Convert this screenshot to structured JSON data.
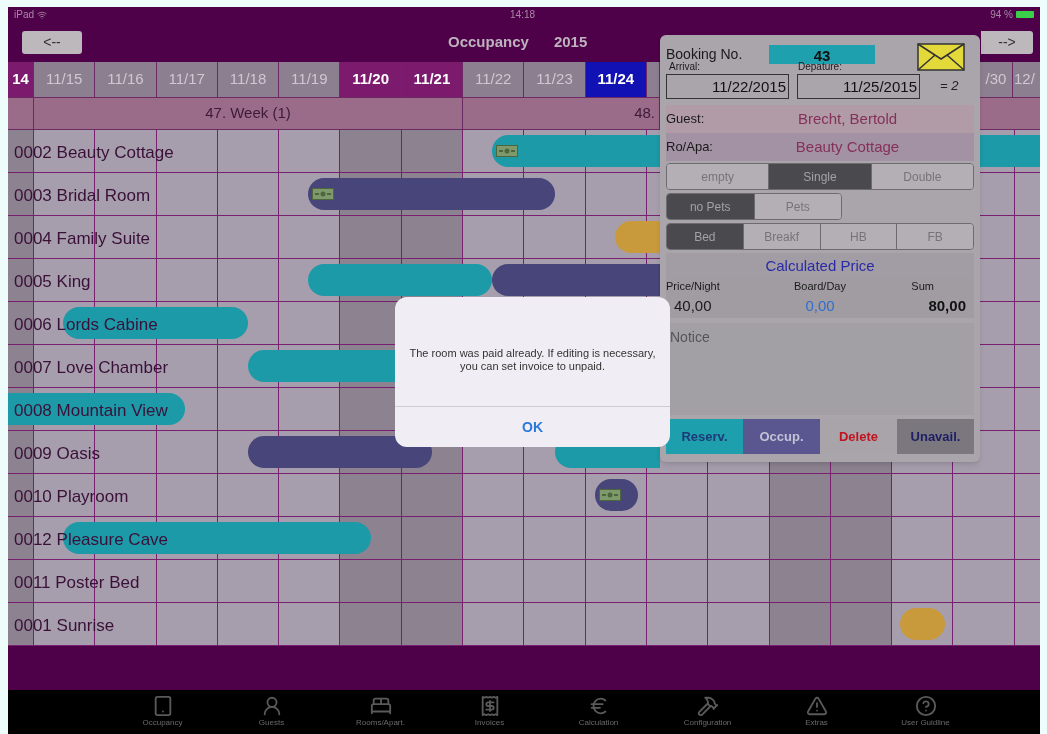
{
  "status_bar": {
    "device": "iPad",
    "time": "14:18",
    "battery": "94 %"
  },
  "nav": {
    "back": "<--",
    "title": "Occupancy",
    "year": "2015",
    "forward": "-->"
  },
  "dates": [
    {
      "label": "14",
      "weekend": true,
      "selected": false
    },
    {
      "label": "11/15",
      "weekend": false,
      "selected": false
    },
    {
      "label": "11/16",
      "weekend": false,
      "selected": false
    },
    {
      "label": "11/17",
      "weekend": false,
      "selected": false
    },
    {
      "label": "11/18",
      "weekend": false,
      "selected": false
    },
    {
      "label": "11/19",
      "weekend": false,
      "selected": false
    },
    {
      "label": "11/20",
      "weekend": true,
      "selected": false
    },
    {
      "label": "11/21",
      "weekend": true,
      "selected": false
    },
    {
      "label": "11/22",
      "weekend": false,
      "selected": false
    },
    {
      "label": "11/23",
      "weekend": false,
      "selected": false
    },
    {
      "label": "11/24",
      "weekend": false,
      "selected": true
    },
    {
      "weekend": false
    },
    {
      "weekend": false
    },
    {
      "weekend": true
    },
    {
      "weekend": true
    },
    {
      "weekend": false
    },
    {
      "label": "/30",
      "weekend": false,
      "selected": false
    },
    {
      "label": "12/",
      "weekend": false,
      "selected": false
    }
  ],
  "weeks": [
    {
      "label": "47. Week (1)"
    },
    {
      "label": "48."
    }
  ],
  "rooms": [
    {
      "name": "0002 Beauty Cottage",
      "bookings": [
        {
          "color": "#1c9aa8",
          "paid": true
        },
        {
          "color": "#1c9aa8",
          "paid": false
        }
      ]
    },
    {
      "name": "0003 Bridal Room",
      "bookings": [
        {
          "color": "#47457a",
          "paid": true
        }
      ]
    },
    {
      "name": "0004 Family Suite",
      "bookings": [
        {
          "color": "#c99a3c",
          "paid": false
        }
      ]
    },
    {
      "name": "0005 King",
      "bookings": [
        {
          "color": "#1c9aa8",
          "paid": false
        },
        {
          "color": "#47457a",
          "paid": false
        }
      ]
    },
    {
      "name": "0006 Lords Cabine",
      "bookings": [
        {
          "color": "#1c9aa8",
          "paid": false
        }
      ]
    },
    {
      "name": "0007 Love Chamber",
      "bookings": [
        {
          "color": "#1c9aa8",
          "paid": false
        }
      ]
    },
    {
      "name": "0008 Mountain View",
      "bookings": [
        {
          "color": "#1c9aa8",
          "paid": false
        }
      ]
    },
    {
      "name": "0009 Oasis",
      "bookings": [
        {
          "color": "#47457a",
          "paid": false
        },
        {
          "color": "#1c9aa8",
          "paid": false
        }
      ]
    },
    {
      "name": "0010 Playroom",
      "bookings": [
        {
          "color": "#47457a",
          "paid": true
        }
      ]
    },
    {
      "name": "0012 Pleasure Cave",
      "bookings": [
        {
          "color": "#1c9aa8",
          "paid": false
        }
      ]
    },
    {
      "name": "0011 Poster Bed"
    },
    {
      "name": "0001 Sunrise",
      "bookings": [
        {
          "color": "#c99a3c",
          "paid": false
        }
      ]
    }
  ],
  "booking": {
    "number_label": "Booking No.",
    "number": "43",
    "arrival_label": "Arrival:",
    "arrival": "11/22/2015",
    "departure_label": "Depature:",
    "departure": "11/25/2015",
    "nights": "= 2",
    "guest_label": "Guest:",
    "guest": "Brecht, Bertold",
    "room_label": "Ro/Apa:",
    "room": "Beauty Cottage",
    "occupancy": [
      {
        "label": "empty",
        "selected": false
      },
      {
        "label": "Single",
        "selected": true
      },
      {
        "label": "Double",
        "selected": false
      }
    ],
    "pets": [
      {
        "label": "no Pets",
        "selected": true
      },
      {
        "label": "Pets",
        "selected": false
      }
    ],
    "board": [
      {
        "label": "Bed",
        "selected": true
      },
      {
        "label": "Breakf",
        "selected": false
      },
      {
        "label": "HB",
        "selected": false
      },
      {
        "label": "FB",
        "selected": false
      }
    ],
    "price_title": "Calculated Price",
    "prices": [
      {
        "label": "Price/Night",
        "value": "40,00"
      },
      {
        "label": "Board/Day",
        "value": "0,00"
      },
      {
        "label": "Sum",
        "value": "80,00"
      }
    ],
    "notice": {
      "placeholder": "Notice"
    },
    "actions": [
      {
        "label": "Reserv.",
        "kind": "reserve"
      },
      {
        "label": "Occup.",
        "kind": "occupy"
      },
      {
        "label": "Delete",
        "kind": "delete"
      },
      {
        "label": "Unavail.",
        "kind": "unavailable"
      }
    ]
  },
  "alert": {
    "message": "The room was paid already. If editing is necessary, you can set invoice to unpaid.",
    "button": "OK"
  },
  "tabs": [
    {
      "label": "Occupancy"
    },
    {
      "label": "Guests"
    },
    {
      "label": "Rooms/Apart."
    },
    {
      "label": "Invoices"
    },
    {
      "label": "Calculation"
    },
    {
      "label": "Configuration"
    },
    {
      "label": "Extras"
    },
    {
      "label": "User Guidline"
    }
  ]
}
